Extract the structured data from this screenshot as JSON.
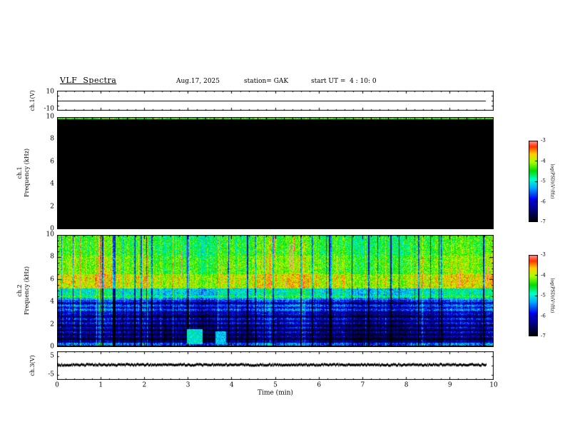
{
  "header": {
    "title": "VLF  Spectra",
    "date": "Aug.17, 2025",
    "station": "station= GAK",
    "start_ut": "start UT =  4 : 10: 0"
  },
  "x_axis": {
    "label": "Time (min)",
    "ticks": [
      "0",
      "1",
      "2",
      "3",
      "4",
      "5",
      "6",
      "7",
      "8",
      "9",
      "10"
    ],
    "range": [
      0,
      10
    ]
  },
  "freq_axis": {
    "ticks": [
      "0",
      "2",
      "4",
      "6",
      "8",
      "10"
    ],
    "range": [
      0,
      10
    ]
  },
  "panels": {
    "ch1v": {
      "label": "ch.1(V)",
      "tick_top": "10",
      "tick_bottom": "-10",
      "range": [
        -10,
        10
      ]
    },
    "ch1s": {
      "label_line1": "ch.1",
      "label_line2": "Frequency (kHz)"
    },
    "ch2s": {
      "label_line1": "ch.2",
      "label_line2": "Frequency (kHz)"
    },
    "ch3v": {
      "label": "ch.3(V)",
      "tick_top": "5",
      "tick_bottom": "-5",
      "range": [
        -7.5,
        7.5
      ]
    }
  },
  "colorbar": {
    "label": "log(PSD)(V²/Hz)",
    "ticks": [
      "-3",
      "-4",
      "-5",
      "-6",
      "-7"
    ],
    "range": [
      -3,
      -7
    ]
  },
  "colormap": {
    "stops": [
      {
        "t": 0.0,
        "color": "#000000"
      },
      {
        "t": 0.12,
        "color": "#000066"
      },
      {
        "t": 0.28,
        "color": "#0000ee"
      },
      {
        "t": 0.42,
        "color": "#00aaff"
      },
      {
        "t": 0.52,
        "color": "#00ffcc"
      },
      {
        "t": 0.63,
        "color": "#00dd00"
      },
      {
        "t": 0.74,
        "color": "#aaff00"
      },
      {
        "t": 0.84,
        "color": "#ffcc00"
      },
      {
        "t": 0.93,
        "color": "#ff3300"
      },
      {
        "t": 1.0,
        "color": "#ff9999"
      }
    ]
  },
  "chart_data": [
    {
      "type": "line",
      "panel": "ch.1(V)",
      "ylabel": "ch.1(V)",
      "ylim": [
        -10,
        10
      ],
      "x_range_min": [
        0,
        9.83
      ],
      "series": [
        {
          "name": "ch1 voltage",
          "value_flat": 0.0,
          "note": "flat thin line across the panel"
        }
      ]
    },
    {
      "type": "heatmap",
      "panel": "ch.1 spectrogram",
      "ylabel": "ch.1 Frequency (kHz)",
      "xlim": [
        0,
        10
      ],
      "ylim": [
        0,
        10
      ],
      "zlabel": "log(PSD)(V^2/Hz)",
      "zlim": [
        -7,
        -3
      ],
      "background_level": -7,
      "noise_amplitude": 0.5,
      "bands": [
        {
          "freq_khz": [
            9.87,
            10.01
          ],
          "level": -4.3,
          "note": "thin bright strip at top edge"
        },
        {
          "freq_khz": [
            0,
            9.87
          ],
          "level": -7,
          "note": "below color scale - rendered black"
        }
      ]
    },
    {
      "type": "heatmap",
      "panel": "ch.2 spectrogram",
      "ylabel": "ch.2 Frequency (kHz)",
      "xlim": [
        0,
        10
      ],
      "ylim": [
        0,
        10
      ],
      "zlabel": "log(PSD)(V^2/Hz)",
      "zlim": [
        -7,
        -3
      ],
      "noise_amplitude": 0.45,
      "bands": [
        {
          "freq_khz": [
            9.6,
            10.01
          ],
          "level": -4.5
        },
        {
          "freq_khz": [
            8.2,
            9.6
          ],
          "level": -4.45
        },
        {
          "freq_khz": [
            6.5,
            8.2
          ],
          "level": -4.25
        },
        {
          "freq_khz": [
            5.2,
            6.5
          ],
          "level": -3.9,
          "note": "brightest yellow band near 5.5-6.5 kHz"
        },
        {
          "freq_khz": [
            4.2,
            5.2
          ],
          "level": -5.0
        },
        {
          "freq_khz": [
            3.0,
            4.2
          ],
          "level": -5.9
        },
        {
          "freq_khz": [
            1.5,
            3.0
          ],
          "level": -6.3
        },
        {
          "freq_khz": [
            0.35,
            1.5
          ],
          "level": -6.55
        },
        {
          "freq_khz": [
            0.1,
            0.35
          ],
          "level": -5.6,
          "note": "thin brighter strip just above 0"
        },
        {
          "freq_khz": [
            0,
            0.1
          ],
          "level": -6.9
        }
      ],
      "column_effects": {
        "dropout_prob": 0.06,
        "dropout_delta": -1.3,
        "bright_prob": 0.05,
        "bright_delta": 0.7,
        "red_streak_prob": 0.03,
        "red_streak_delta": 1.4,
        "note": "many narrow vertical dark dropout lines and sporadic red vertical dashes above ~5 kHz"
      },
      "horizontal_banding": {
        "below_khz": 4.6,
        "period_khz": 0.4,
        "amplitude": 0.35
      },
      "patches": [
        {
          "t_min": 3.15,
          "freq_khz": 0.9,
          "level": -5.0,
          "dt": 0.18,
          "df": 0.7
        },
        {
          "t_min": 3.75,
          "freq_khz": 0.8,
          "level": -5.2,
          "dt": 0.12,
          "df": 0.6
        }
      ]
    },
    {
      "type": "line",
      "panel": "ch.3(V)",
      "ylabel": "ch.3(V)",
      "ylim": [
        -7.5,
        7.5
      ],
      "x_range_min": [
        0,
        9.83
      ],
      "series": [
        {
          "name": "ch3 voltage",
          "value_flat": 0.4,
          "thickness_v": 0.6,
          "note": "thick ragged dark trace near 0 V"
        }
      ]
    }
  ]
}
